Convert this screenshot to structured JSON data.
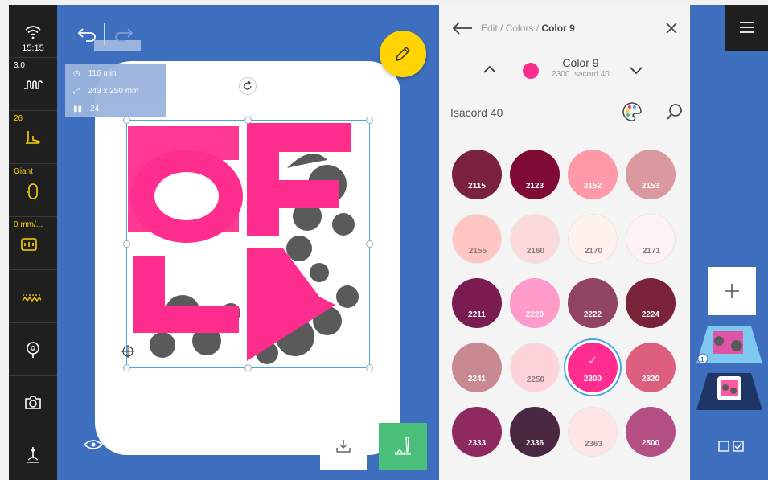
{
  "status": {
    "time": "15:15",
    "thread_tension": "3.0",
    "presser_foot_height": "26",
    "hoop_name": "Giant",
    "stitch_length": "0 mm/..."
  },
  "design_info": {
    "time": "116 min",
    "size": "243 x 250 mm",
    "color_count": "24"
  },
  "panel": {
    "breadcrumb_edit": "Edit",
    "breadcrumb_colors": "Colors",
    "breadcrumb_current": "Color 9",
    "selected_color_name": "Color 9",
    "selected_color_sub": "2300 Isacord 40",
    "selected_color_hex": "#ff2e8e",
    "thread_brand": "Isacord 40",
    "swatches": [
      {
        "code": "2115",
        "color": "#7a2140"
      },
      {
        "code": "2123",
        "color": "#7f0a33"
      },
      {
        "code": "2152",
        "color": "#ff99a8"
      },
      {
        "code": "2153",
        "color": "#d9999f"
      },
      {
        "code": "2155",
        "color": "#ffc5c3"
      },
      {
        "code": "2160",
        "color": "#fadada"
      },
      {
        "code": "2170",
        "color": "#fff2ec"
      },
      {
        "code": "2171",
        "color": "#fff2f6"
      },
      {
        "code": "2211",
        "color": "#7a1c52"
      },
      {
        "code": "2220",
        "color": "#ff9ac9"
      },
      {
        "code": "2222",
        "color": "#904363"
      },
      {
        "code": "2224",
        "color": "#792239"
      },
      {
        "code": "2241",
        "color": "#c98990"
      },
      {
        "code": "2250",
        "color": "#ffd3da"
      },
      {
        "code": "2300",
        "color": "#ff2e8e"
      },
      {
        "code": "2320",
        "color": "#dd5f7e"
      },
      {
        "code": "2333",
        "color": "#8f2a60"
      },
      {
        "code": "2336",
        "color": "#4b2841"
      },
      {
        "code": "2363",
        "color": "#ffe5e5"
      },
      {
        "code": "2500",
        "color": "#b44f83"
      }
    ],
    "selected_swatch_index": 14
  },
  "colors": {
    "canvas_bg": "#3e6fbf",
    "toolbar_bg": "#1f1f1f",
    "accent_yellow": "#ffd400",
    "stitch_green": "#49bf7a",
    "design_pink": "#ff2e8e",
    "design_gray": "#5a5a5a",
    "selection_blue": "#49a8e3"
  },
  "right_strip": {
    "thumb1_badge": "1"
  }
}
